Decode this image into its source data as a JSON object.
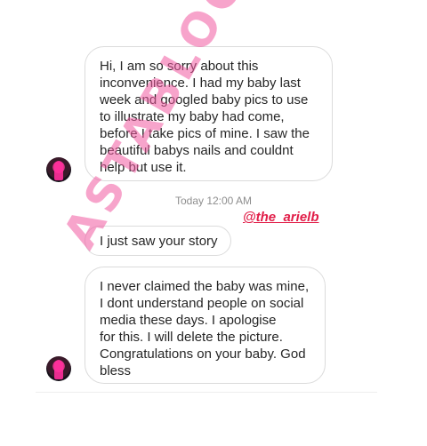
{
  "messages": [
    {
      "text": "Hi, I am so sorry about this\ninconvenience. I had my baby last\nweek and googled baby pics to use\nto illustrate my baby had come,\nbefore I take pics of mine. I saw the\nbeautiful babys nails and couldnt\nhelp but use it."
    },
    {
      "text": "I just saw your story"
    },
    {
      "text": "I never claimed the baby was mine,\nI dont understand people on social\nmedia these days. I apologise\nfor this. I will delete the picture.\nCongratulations on your baby. God\nbless"
    }
  ],
  "timestamp": "Today 12:00 AM",
  "credit_handle": "@the_arielb",
  "watermark": "ASTABLOGGS.A",
  "colors": {
    "bubble_border": "#dbdbdb",
    "text": "#262626",
    "timestamp": "#8e8e8e",
    "handle": "#e11d48",
    "watermark": "#f05aa0"
  }
}
